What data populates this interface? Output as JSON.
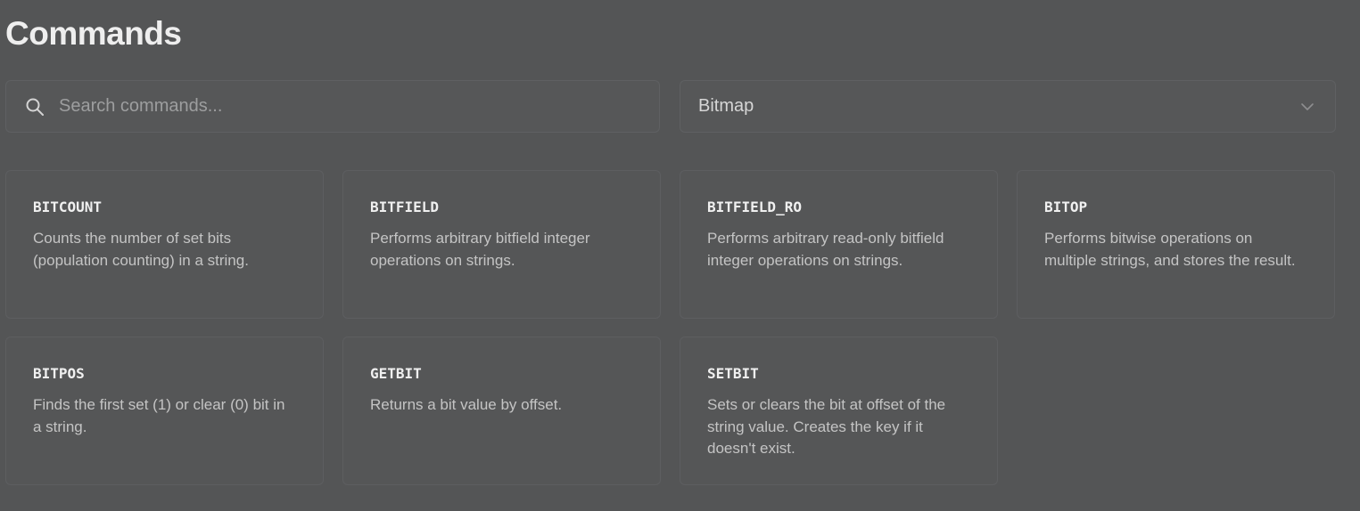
{
  "page": {
    "title": "Commands"
  },
  "search": {
    "placeholder": "Search commands...",
    "value": ""
  },
  "category": {
    "selected": "Bitmap"
  },
  "icons": {
    "search": "search-icon",
    "chevron": "chevron-down-icon"
  },
  "colors": {
    "background": "#545556",
    "card_border": "#5d5e60",
    "text_primary": "#f0f0f0",
    "text_secondary": "#c4c4c4"
  },
  "commands": [
    {
      "name": "BITCOUNT",
      "description": "Counts the number of set bits (population counting) in a string."
    },
    {
      "name": "BITFIELD",
      "description": "Performs arbitrary bitfield integer operations on strings."
    },
    {
      "name": "BITFIELD_RO",
      "description": "Performs arbitrary read-only bitfield integer operations on strings."
    },
    {
      "name": "BITOP",
      "description": "Performs bitwise operations on multiple strings, and stores the result."
    },
    {
      "name": "BITPOS",
      "description": "Finds the first set (1) or clear (0) bit in a string."
    },
    {
      "name": "GETBIT",
      "description": "Returns a bit value by offset."
    },
    {
      "name": "SETBIT",
      "description": "Sets or clears the bit at offset of the string value. Creates the key if it doesn't exist."
    }
  ]
}
